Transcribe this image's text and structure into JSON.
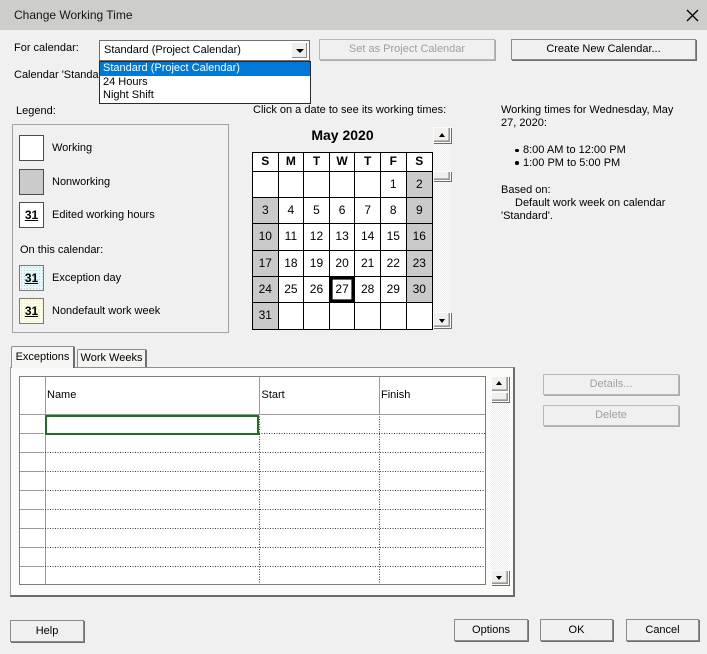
{
  "window": {
    "title": "Change Working Time",
    "close_icon": "x"
  },
  "colors": {
    "titlebar": "#cdcdcb",
    "dialog_bg": "#f0f0f0",
    "selection_blue": "#0078d7",
    "selected_cell_green": "#1e7122",
    "nonworking_gray": "#cacaca",
    "exception_fill": "#e7f6f9",
    "nondefault_fill": "#fcfbe4"
  },
  "for_calendar": {
    "label": "For calendar:",
    "value": "Standard (Project Calendar)",
    "options": [
      "Standard (Project Calendar)",
      "24 Hours",
      "Night Shift"
    ],
    "selected_index": 0
  },
  "top_buttons": {
    "set_as_project": "Set as Project Calendar",
    "create_new": "Create New Calendar..."
  },
  "calendar_note": "Calendar 'Standa",
  "legend": {
    "label": "Legend:",
    "working": "Working",
    "nonworking": "Nonworking",
    "edited": "Edited working hours",
    "on_this_calendar": "On this calendar:",
    "exception": "Exception day",
    "nondefault": "Nondefault work week",
    "swatch_number": "31"
  },
  "calendar": {
    "prompt": "Click on a date to see its working times:",
    "month_title": "May 2020",
    "day_headers": [
      "S",
      "M",
      "T",
      "W",
      "T",
      "F",
      "S"
    ],
    "weeks": [
      [
        "",
        "",
        "",
        "",
        "",
        "1",
        "2"
      ],
      [
        "3",
        "4",
        "5",
        "6",
        "7",
        "8",
        "9"
      ],
      [
        "10",
        "11",
        "12",
        "13",
        "14",
        "15",
        "16"
      ],
      [
        "17",
        "18",
        "19",
        "20",
        "21",
        "22",
        "23"
      ],
      [
        "24",
        "25",
        "26",
        "27",
        "28",
        "29",
        "30"
      ],
      [
        "31",
        "",
        "",
        "",
        "",
        "",
        ""
      ]
    ],
    "selected_date": "27"
  },
  "working_times": {
    "heading": "Working times for Wednesday, May 27, 2020:",
    "times": [
      "8:00 AM to 12:00 PM",
      "1:00 PM to 5:00 PM"
    ],
    "based_on_label": "Based on:",
    "based_on_text": "Default work week on calendar 'Standard'."
  },
  "tabs": {
    "exceptions": "Exceptions",
    "work_weeks": "Work Weeks"
  },
  "table": {
    "columns": [
      "Name",
      "Start",
      "Finish"
    ],
    "row_count": 9,
    "rows": [
      [
        "",
        "",
        ""
      ],
      [
        "",
        "",
        ""
      ],
      [
        "",
        "",
        ""
      ],
      [
        "",
        "",
        ""
      ],
      [
        "",
        "",
        ""
      ],
      [
        "",
        "",
        ""
      ],
      [
        "",
        "",
        ""
      ],
      [
        "",
        "",
        ""
      ],
      [
        "",
        "",
        ""
      ]
    ],
    "selected_cell": {
      "row": 0,
      "column": "Name"
    }
  },
  "side_buttons": {
    "details": "Details...",
    "delete": "Delete"
  },
  "bottom_buttons": {
    "help": "Help",
    "options": "Options",
    "ok": "OK",
    "cancel": "Cancel"
  }
}
